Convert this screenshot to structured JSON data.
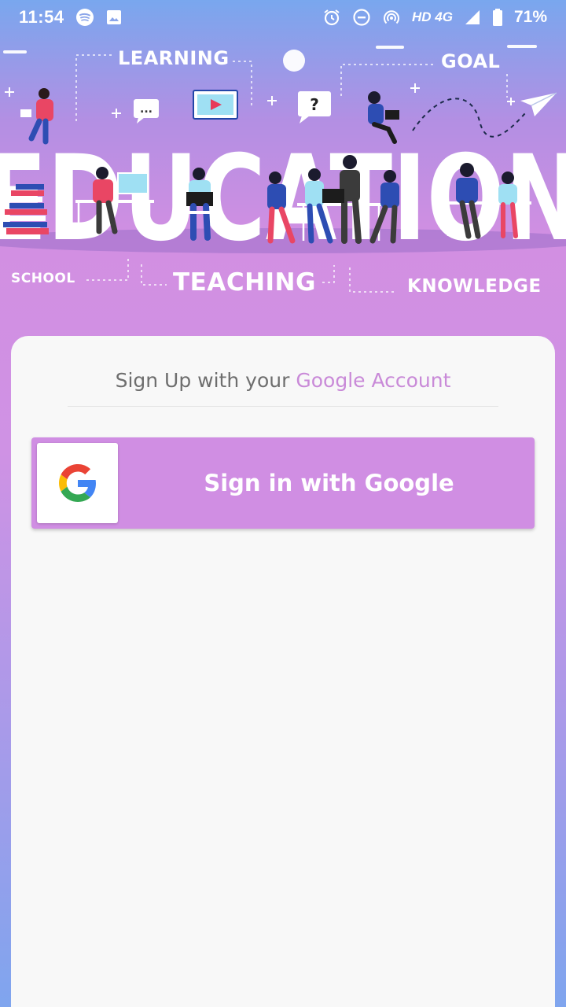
{
  "status_bar": {
    "time": "11:54",
    "network": "HD 4G",
    "battery": "71%",
    "left_icons": [
      "spotify-icon",
      "image-icon"
    ],
    "right_icons": [
      "alarm-icon",
      "do-not-disturb-icon",
      "hotspot-icon",
      "signal-icon",
      "battery-icon"
    ]
  },
  "hero": {
    "words": {
      "learning": "LEARNING",
      "goal": "GOAL",
      "education": "EDUCATION",
      "school": "SCHOOL",
      "teaching": "TEACHING",
      "knowledge": "KNOWLEDGE"
    },
    "bubble_question": "?",
    "bubble_dots": "..."
  },
  "card": {
    "signup_prefix": "Sign Up with your",
    "signup_accent": "Google Account",
    "google_button_label": "Sign in with Google"
  },
  "colors": {
    "accent": "#d08ee3",
    "accent_text": "#c98ad8",
    "card_bg": "#f8f8f8",
    "top_gradient": "#79a7ee",
    "mid_gradient": "#d28fe2"
  }
}
